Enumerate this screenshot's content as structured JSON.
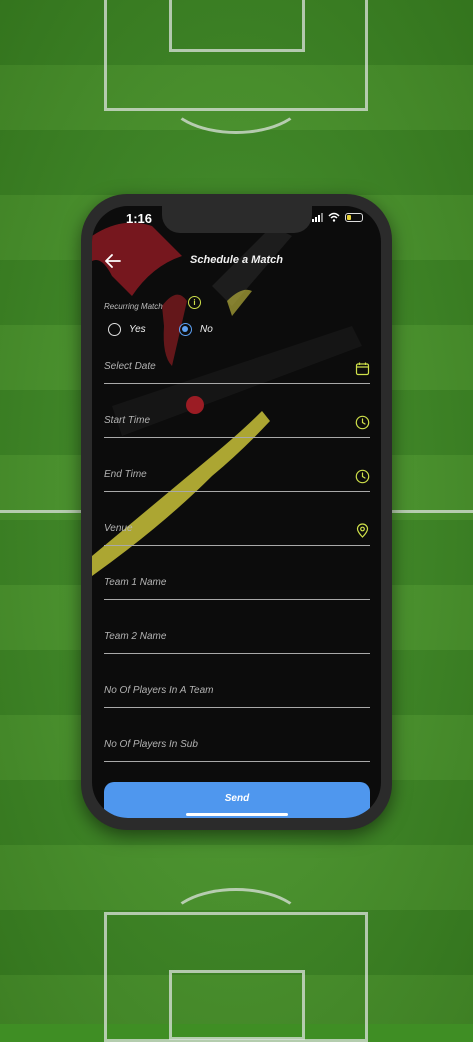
{
  "status_bar": {
    "time": "1:16"
  },
  "header": {
    "back_icon": "arrow-left-icon",
    "title": "Schedule a Match"
  },
  "recurring": {
    "label": "Recurring Match",
    "info_icon": "info-icon",
    "options": [
      {
        "label": "Yes",
        "selected": false
      },
      {
        "label": "No",
        "selected": true
      }
    ]
  },
  "form": {
    "fields": [
      {
        "label": "Select Date",
        "icon": "calendar-icon"
      },
      {
        "label": "Start Time",
        "icon": "clock-icon"
      },
      {
        "label": "End Time",
        "icon": "clock-icon"
      },
      {
        "label": "Venue",
        "icon": "location-pin-icon"
      },
      {
        "label": "Team 1 Name",
        "icon": ""
      },
      {
        "label": "Team 2 Name",
        "icon": ""
      },
      {
        "label": "No Of Players In A Team",
        "icon": ""
      },
      {
        "label": "No Of Players In Sub",
        "icon": ""
      }
    ],
    "send_label": "Send"
  },
  "colors": {
    "accent": "#4f97ee",
    "icon_yellow": "#cfe04a",
    "screen_bg": "#0c0c0c",
    "pitch_green": "#4c9c2c"
  }
}
